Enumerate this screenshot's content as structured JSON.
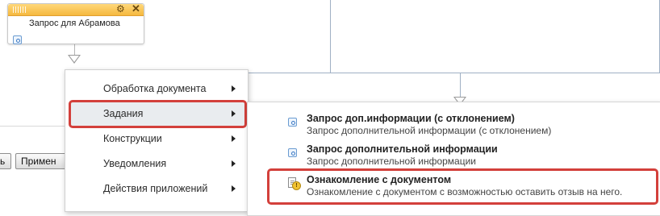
{
  "activity_block": {
    "title": "Запрос для Абрамова",
    "settings_icon": "gear-icon",
    "close_icon": "close-icon",
    "close_glyph": "✕",
    "gear_glyph": "⚙"
  },
  "buttons": {
    "partial_left_label": "ь",
    "apply_label": "Примен"
  },
  "main_menu": {
    "items": [
      {
        "label": "Обработка документа",
        "active": false
      },
      {
        "label": "Задания",
        "active": true
      },
      {
        "label": "Конструкции",
        "active": false
      },
      {
        "label": "Уведомления",
        "active": false
      },
      {
        "label": "Действия приложений",
        "active": false
      }
    ]
  },
  "submenu": {
    "items": [
      {
        "title": "Запрос доп.информации (с отклонением)",
        "description": "Запрос дополнительной информации (с отклонением)",
        "icon": "task-icon"
      },
      {
        "title": "Запрос дополнительной информации",
        "description": "Запрос дополнительной информации",
        "icon": "task-icon"
      },
      {
        "title": "Ознакомление с документом",
        "description": "Ознакомление с документом с возможностью оставить отзыв на него.",
        "icon": "document-review-icon",
        "warn_glyph": "!"
      }
    ]
  },
  "colors": {
    "highlight": "#d3403b",
    "header_orange": "#f5b83f",
    "connector": "#9fb0c4"
  }
}
